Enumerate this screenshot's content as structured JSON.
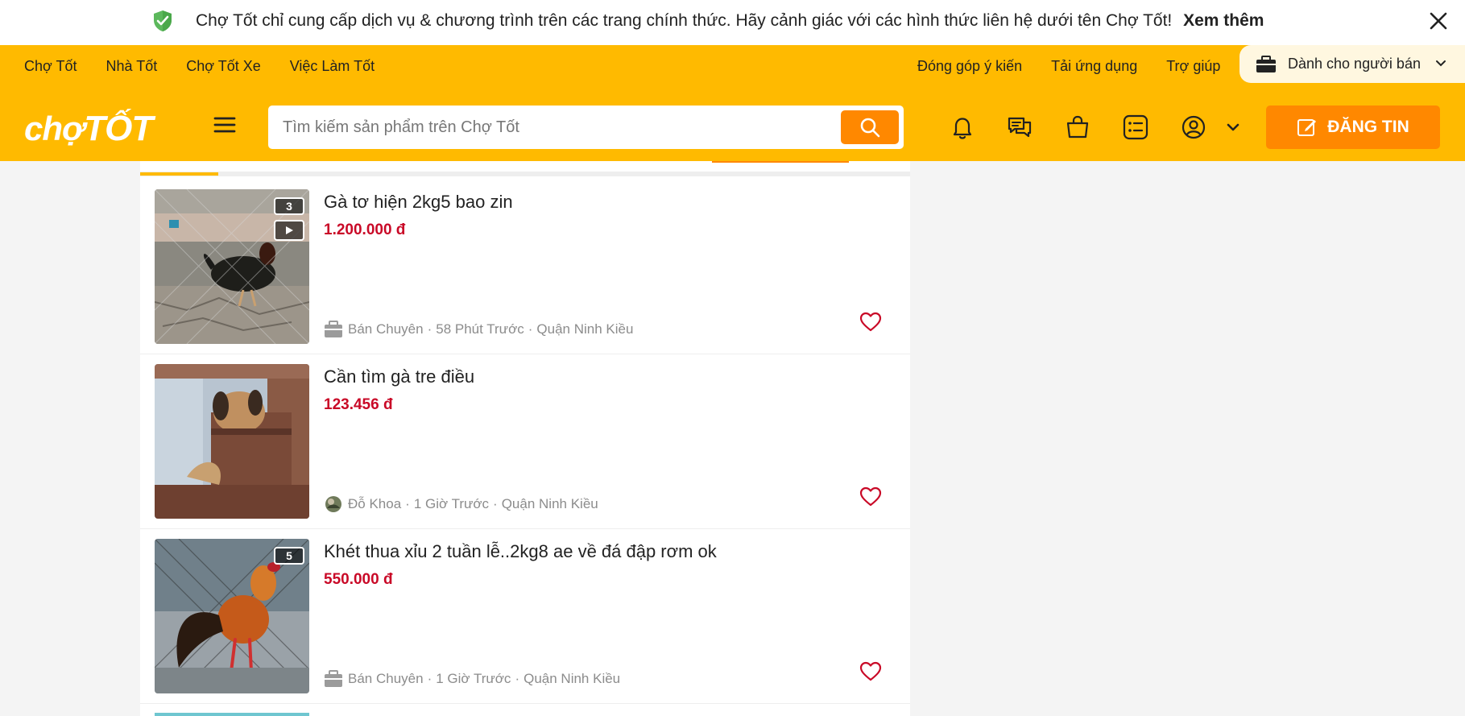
{
  "banner": {
    "message": "Chợ Tốt chỉ cung cấp dịch vụ & chương trình trên các trang chính thức. Hãy cảnh giác với các hình thức liên hệ dưới tên Chợ Tốt!",
    "more_link": "Xem thêm",
    "icons": {
      "shield": "shield-check-icon",
      "close": "close-icon"
    }
  },
  "nav": {
    "links": [
      "Chợ Tốt",
      "Nhà Tốt",
      "Chợ Tốt Xe",
      "Việc Làm Tốt"
    ],
    "right_links": [
      "Đóng góp ý kiến",
      "Tải ứng dụng",
      "Trợ giúp"
    ],
    "seller_label": "Dành cho người bán",
    "brand_color": "#ffba00",
    "accent_color": "#ff8800"
  },
  "header": {
    "logo_text_a": "chợ",
    "logo_text_b": "TỐT",
    "search_placeholder": "Tìm kiếm sản phẩm trên Chợ Tốt",
    "post_button": "ĐĂNG TIN",
    "icons": [
      "menu-icon",
      "bell-icon",
      "chat-icon",
      "shopping-bag-icon",
      "list-icon",
      "user-icon",
      "chevron-down-icon"
    ]
  },
  "listings": [
    {
      "title": "Gà tơ hiện 2kg5 bao zin",
      "price": "1.200.000 đ",
      "seller": "Bán Chuyên",
      "time": "58 Phút Trước",
      "location": "Quận Ninh Kiều",
      "photo_count": "3",
      "has_video": true
    },
    {
      "title": "Cần tìm gà tre điều",
      "price": "123.456 đ",
      "seller": "Đỗ Khoa",
      "time": "1 Giờ Trước",
      "location": "Quận Ninh Kiều",
      "photo_count": "",
      "has_video": false
    },
    {
      "title": "Khét thua xỉu 2 tuần lễ..2kg8 ae về đá đập rơm ok",
      "price": "550.000 đ",
      "seller": "Bán Chuyên",
      "time": "1 Giờ Trước",
      "location": "Quận Ninh Kiều",
      "photo_count": "5",
      "has_video": false
    }
  ],
  "meta_separator": "·",
  "price_color": "#c90927"
}
